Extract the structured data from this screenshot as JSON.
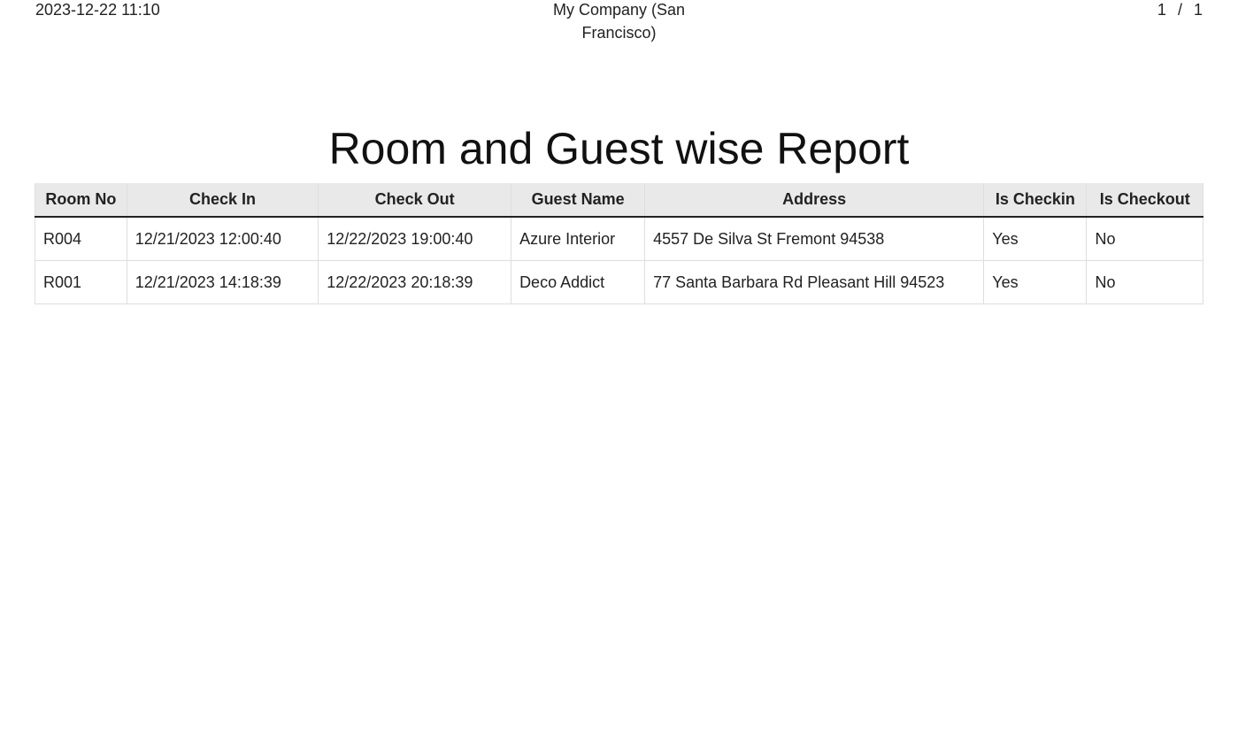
{
  "header": {
    "datetime": "2023-12-22 11:10",
    "company": "My Company (San Francisco)",
    "page_current": "1",
    "page_separator": "/",
    "page_total": "1"
  },
  "report": {
    "title": "Room and Guest wise Report"
  },
  "table": {
    "columns": [
      "Room No",
      "Check In",
      "Check Out",
      "Guest Name",
      "Address",
      "Is Checkin",
      "Is Checkout"
    ],
    "rows": [
      [
        "R004",
        "12/21/2023 12:00:40",
        "12/22/2023 19:00:40",
        "Azure Interior",
        "4557 De Silva St Fremont 94538",
        "Yes",
        "No"
      ],
      [
        "R001",
        "12/21/2023 14:18:39",
        "12/22/2023 20:18:39",
        "Deco Addict",
        "77 Santa Barbara Rd Pleasant Hill 94523",
        "Yes",
        "No"
      ]
    ]
  }
}
